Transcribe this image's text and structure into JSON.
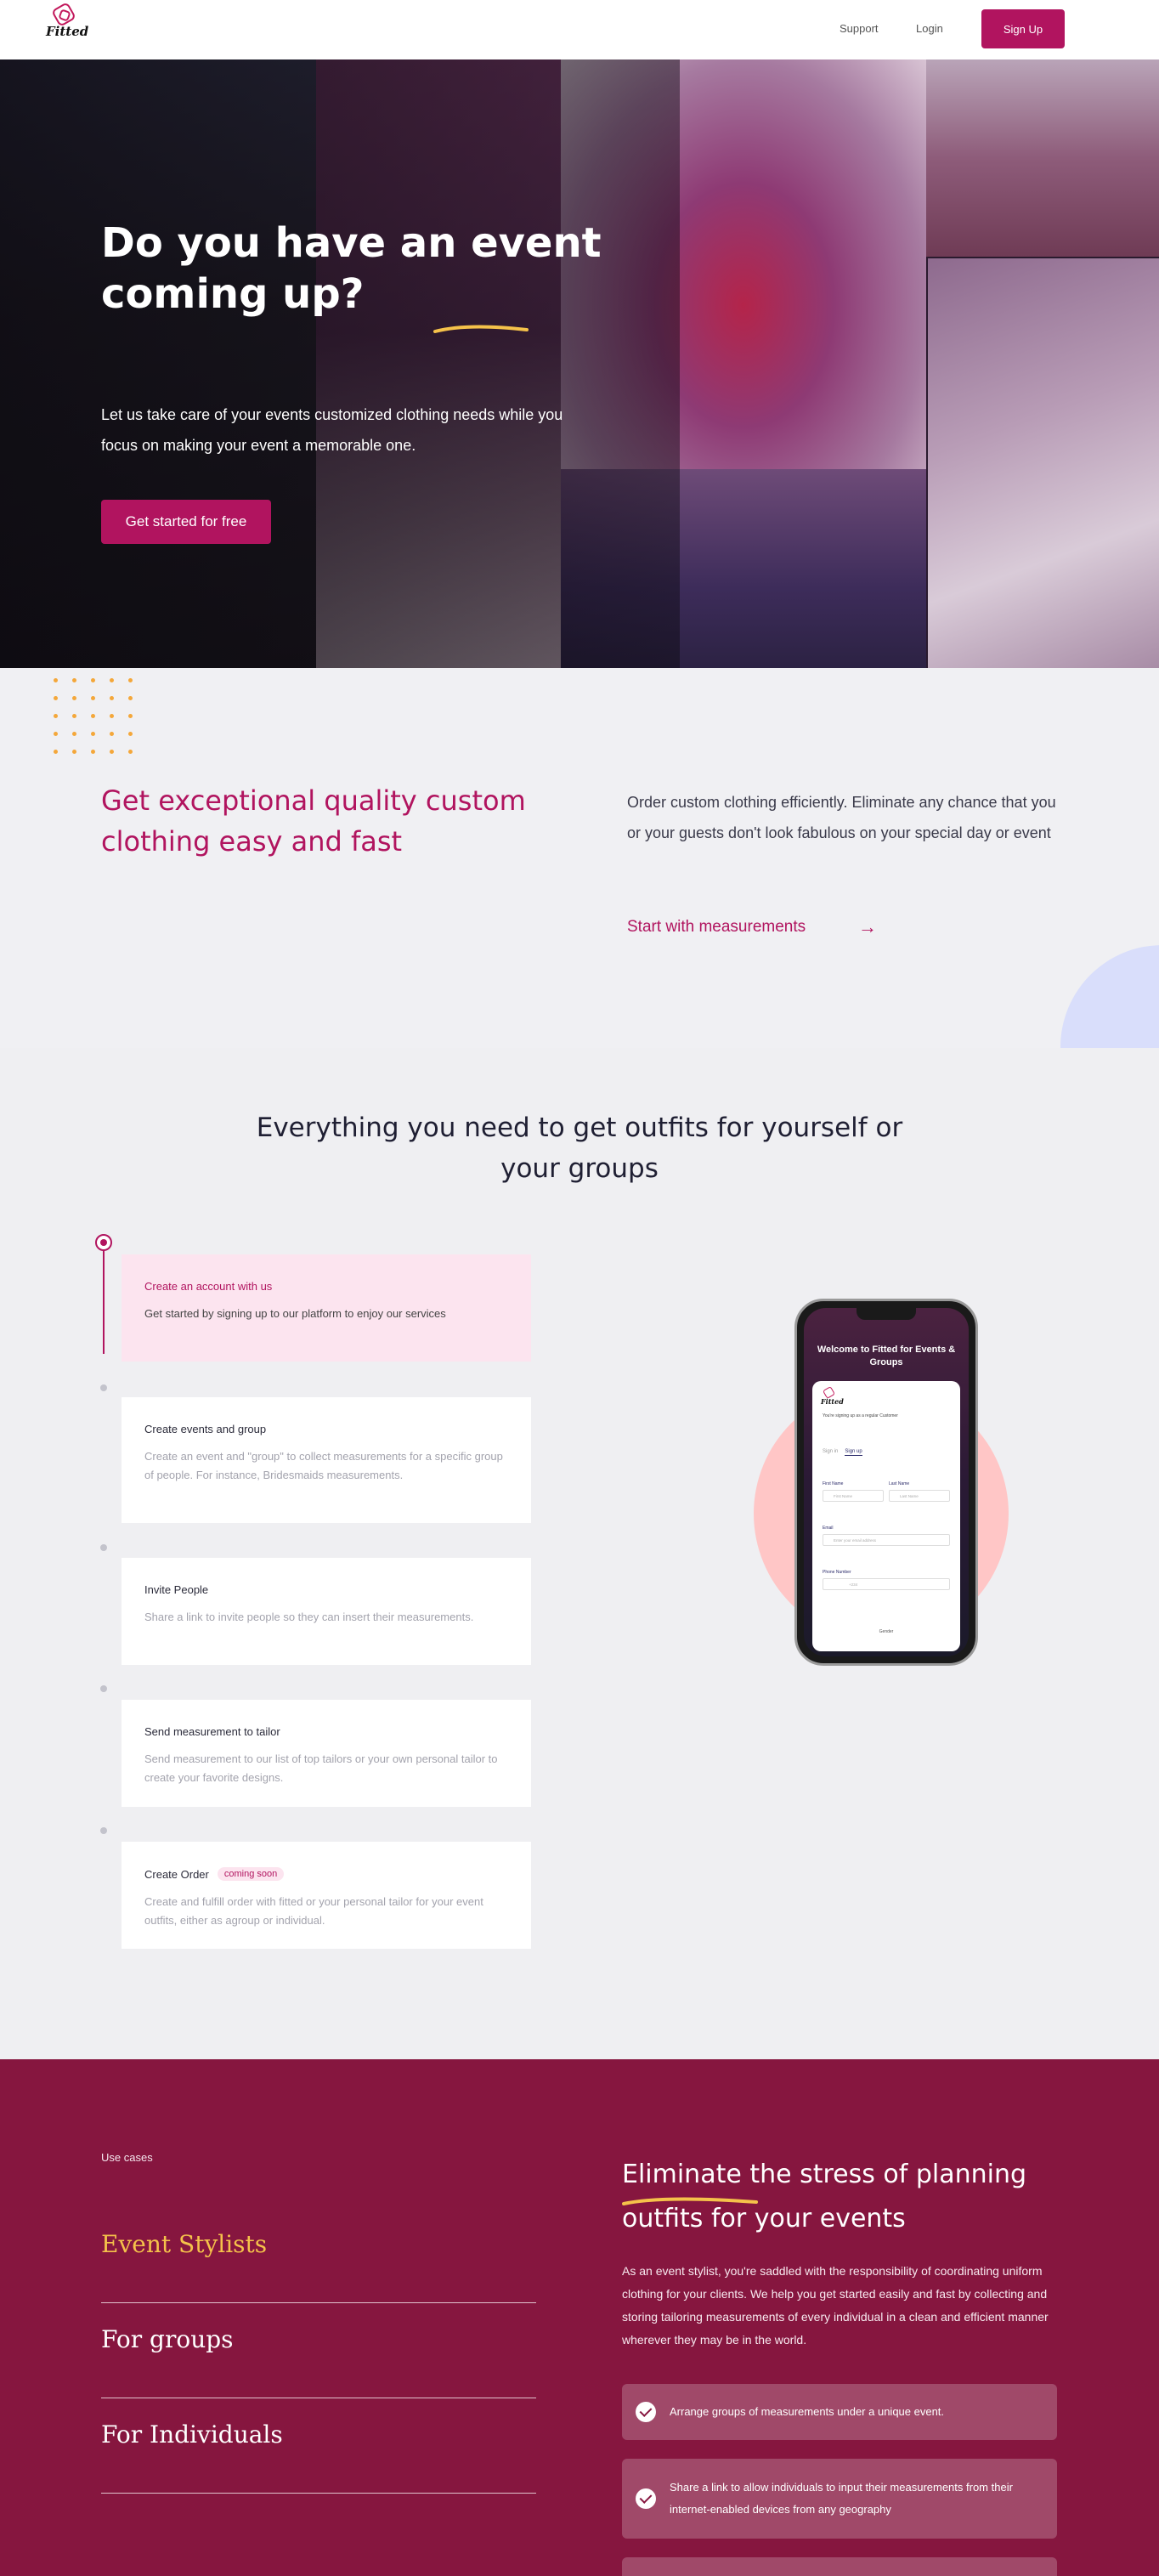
{
  "nav": {
    "logo_text": "Fitted",
    "support": "Support",
    "login": "Login",
    "signup": "Sign Up"
  },
  "hero": {
    "title": "Do you have an event coming up?",
    "subtitle": "Let us take care of your events customized clothing needs while you focus on making your event a memorable one.",
    "cta": "Get started for free"
  },
  "quality": {
    "title": "Get exceptional quality custom clothing easy and fast",
    "description": "Order custom clothing efficiently. Eliminate any chance that you or your guests don't look fabulous on your special day or event",
    "link": "Start with measurements",
    "arrow": "→"
  },
  "features": {
    "title": "Everything you need to get outfits for yourself or your groups",
    "steps": [
      {
        "title": "Create an account with us",
        "desc": "Get started by signing up to our platform to enjoy our services"
      },
      {
        "title": "Create events and group",
        "desc": "Create an event and \"group\" to collect measurements for a specific group of people. For instance, Bridesmaids measurements."
      },
      {
        "title": "Invite People",
        "desc": "Share a link to invite people so they can insert their measurements."
      },
      {
        "title": "Send measurement to tailor",
        "desc": "Send measurement to our list of top tailors or your own personal tailor to create your favorite designs."
      },
      {
        "title": "Create Order",
        "badge": "coming soon",
        "desc": "Create and fulfill order with fitted or your personal tailor for your event outfits, either as agroup or individual."
      }
    ]
  },
  "phone": {
    "welcome": "Welcome to Fitted for Events & Groups",
    "logo_text": "Fitted",
    "sub": "You're signing up as a regular Customer",
    "tab_signin": "Sign in",
    "tab_signup": "Sign up",
    "first_name_label": "First Name",
    "first_name_ph": "First Name",
    "last_name_label": "Last Name",
    "last_name_ph": "Last Name",
    "email_label": "Email",
    "email_ph": "Enter your email address",
    "phone_label": "Phone Number",
    "phone_ph": "+234",
    "gender_label": "Gender"
  },
  "usecases": {
    "label": "Use cases",
    "tabs": [
      "Event Stylists",
      "For groups",
      "For Individuals"
    ],
    "title": "Eliminate the stress of planning outfits for your events",
    "body": "As an event stylist, you're saddled with the responsibility of coordinating uniform clothing for your clients. We help you get started easily and fast by collecting and storing tailoring measurements of every individual in a clean and efficient manner wherever they may be in the world.",
    "features": [
      "Arrange groups of measurements under a unique event.",
      "Share a link to allow individuals to input their measurements from their internet-enabled devices from any geography"
    ]
  },
  "colors": {
    "brand": "#b1145f",
    "usecase_bg": "#86163f",
    "accent": "#f5c24a",
    "dots": "#f4a73a"
  }
}
